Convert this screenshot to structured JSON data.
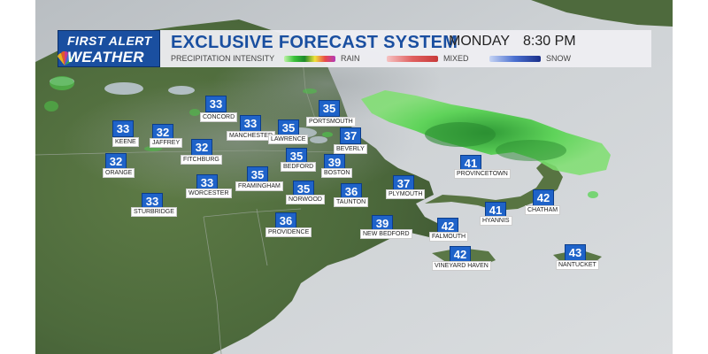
{
  "header": {
    "logo_line1": "FIRST ALERT",
    "logo_line2": "WEATHER",
    "title": "EXCLUSIVE FORECAST SYSTEM",
    "day": "MONDAY",
    "time": "8:30 PM",
    "legend_label": "PRECIPITATION INTENSITY",
    "rain_label": "RAIN",
    "mixed_label": "MIXED",
    "snow_label": "SNOW"
  },
  "colors": {
    "brand_blue": "#1a4fa0",
    "temp_box": "#1f63c9",
    "rain": "#3cc23c",
    "mixed": "#e06060",
    "snow": "#4a6fd0"
  },
  "cities": [
    {
      "name": "CONCORD",
      "temp": "33"
    },
    {
      "name": "PORTSMOUTH",
      "temp": "35"
    },
    {
      "name": "KEENE",
      "temp": "33"
    },
    {
      "name": "JAFFREY",
      "temp": "32"
    },
    {
      "name": "MANCHESTER",
      "temp": "33"
    },
    {
      "name": "LAWRENCE",
      "temp": "35"
    },
    {
      "name": "BEVERLY",
      "temp": "37"
    },
    {
      "name": "FITCHBURG",
      "temp": "32"
    },
    {
      "name": "ORANGE",
      "temp": "32"
    },
    {
      "name": "BEDFORD",
      "temp": "35"
    },
    {
      "name": "BOSTON",
      "temp": "39"
    },
    {
      "name": "FRAMINGHAM",
      "temp": "35"
    },
    {
      "name": "WORCESTER",
      "temp": "33"
    },
    {
      "name": "NORWOOD",
      "temp": "35"
    },
    {
      "name": "TAUNTON",
      "temp": "36"
    },
    {
      "name": "PLYMOUTH",
      "temp": "37"
    },
    {
      "name": "PROVINCETOWN",
      "temp": "41"
    },
    {
      "name": "STURBRIDGE",
      "temp": "33"
    },
    {
      "name": "PROVIDENCE",
      "temp": "36"
    },
    {
      "name": "NEW BEDFORD",
      "temp": "39"
    },
    {
      "name": "FALMOUTH",
      "temp": "42"
    },
    {
      "name": "HYANNIS",
      "temp": "41"
    },
    {
      "name": "CHATHAM",
      "temp": "42"
    },
    {
      "name": "VINEYARD HAVEN",
      "temp": "42"
    },
    {
      "name": "NANTUCKET",
      "temp": "43"
    }
  ]
}
